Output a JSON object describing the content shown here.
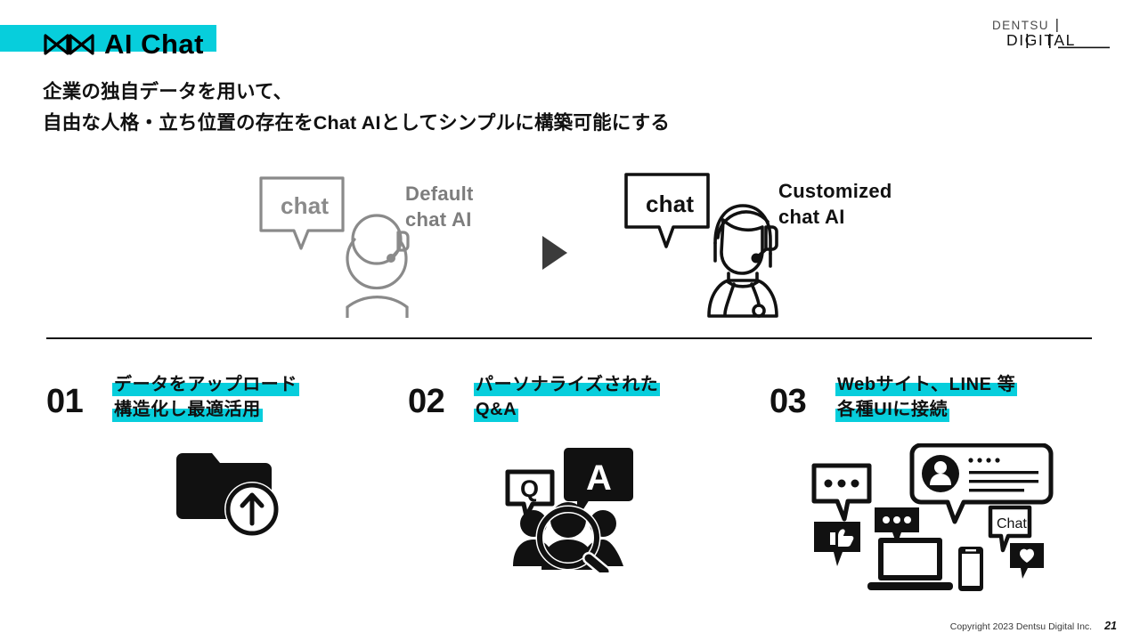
{
  "header": {
    "logo_text": "AI Chat",
    "logo_mark": "infinity-icon",
    "highlight_color": "#07CEDC",
    "brand": {
      "line1": "DENTSU",
      "line2": "DIGITAL",
      "name": "dentsu-digital-logo"
    }
  },
  "subtitle": {
    "line1": "企業の独自データを用いて、",
    "line2": "自由な人格・立ち位置の存在をChat AIとしてシンプルに構築可能にする"
  },
  "hero": {
    "left": {
      "bubble_text": "chat",
      "label_line1": "Default",
      "label_line2": "chat AI",
      "color": "#7d7d7d"
    },
    "arrow": "play-triangle-icon",
    "right": {
      "bubble_text": "chat",
      "label_line1": "Customized",
      "label_line2": "chat AI",
      "color": "#111111"
    }
  },
  "columns": [
    {
      "number": "01",
      "lines": [
        "データをアップロード",
        "構造化し最適活用"
      ],
      "icon": "folder-upload-icon"
    },
    {
      "number": "02",
      "lines": [
        "パーソナライズされた",
        "Q&A"
      ],
      "icon": "qa-people-search-icon",
      "icon_labels": {
        "question": "Q",
        "answer": "A"
      }
    },
    {
      "number": "03",
      "lines": [
        "Webサイト、LINE 等",
        "各種UIに接続"
      ],
      "icon": "multi-device-chat-icon",
      "icon_labels": {
        "chat": "Chat"
      }
    }
  ],
  "footer": {
    "copyright": "Copyright 2023 Dentsu Digital Inc.",
    "page": "21"
  }
}
